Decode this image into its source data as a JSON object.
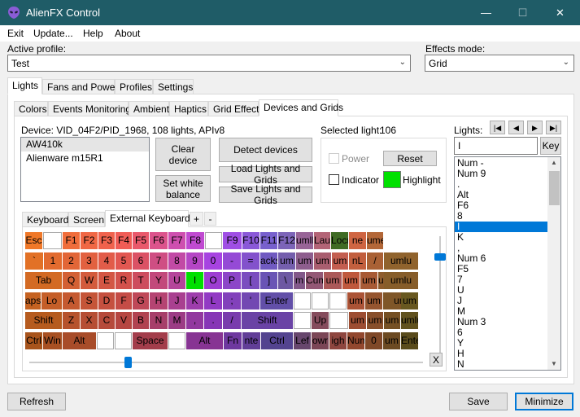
{
  "window": {
    "title": "AlienFX Control",
    "minimize": "—",
    "maximize": "☐",
    "close": "✕"
  },
  "menu": [
    "Exit",
    "Update...",
    "Help",
    "About"
  ],
  "profile": {
    "label": "Active profile:",
    "value": "Test"
  },
  "effects": {
    "label": "Effects mode:",
    "value": "Grid"
  },
  "main_tabs": [
    "Lights",
    "Fans and Power",
    "Profiles",
    "Settings"
  ],
  "sub_tabs": [
    "Colors",
    "Events Monitoring",
    "Ambient",
    "Haptics",
    "Grid Effect",
    "Devices and Grids"
  ],
  "device": {
    "info": "Device: VID_04F2/PID_1968, 108 lights, APIv8",
    "list": [
      "AW410k",
      "Alienware m15R1"
    ],
    "selected_index": 0
  },
  "buttons": {
    "clear_device": "Clear device",
    "detect_devices": "Detect devices",
    "set_white_balance": "Set white balance",
    "load_lights": "Load Lights and Grids",
    "save_lights": "Save Lights and Grids",
    "reset": "Reset",
    "refresh": "Refresh",
    "save": "Save",
    "minimize": "Minimize",
    "key": "Key",
    "grid_add": "+",
    "grid_remove": "-",
    "clear_x": "X"
  },
  "selected_light": {
    "label": "Selected light:",
    "value": "106"
  },
  "checks": {
    "power": "Power",
    "indicator": "Indicator",
    "highlight": "Highlight"
  },
  "colors": {
    "highlight": "#00e000",
    "accent": "#0078d7",
    "titlebar": "#1f5c67"
  },
  "grid_tabs": [
    "Keyboard",
    "Screen",
    "External Keyboard"
  ],
  "lights": {
    "label": "Lights:",
    "search": "I",
    "nav": [
      "|◀",
      "◀",
      "▶",
      "▶|"
    ],
    "items": [
      "Num -",
      "Num 9",
      ".",
      "Alt",
      "F6",
      "8",
      "I",
      "K",
      ",",
      "Num 6",
      "F5",
      "7",
      "U",
      "J",
      "M",
      "Num 3",
      "6",
      "Y",
      "H",
      "N"
    ],
    "selected_index": 6
  },
  "keyboard": {
    "rows": [
      [
        "Esc",
        "",
        "F1",
        "F2",
        "F3",
        "F4",
        "F5",
        "F6",
        "F7",
        "F8",
        "",
        "F9",
        "F10",
        "F11",
        "F12",
        "umlL",
        "Lause",
        "Locne",
        "ne",
        "ume"
      ],
      [
        "`",
        "1",
        "2",
        "3",
        "4",
        "5",
        "6",
        "7",
        "8",
        "9",
        "0",
        "-",
        "=",
        "acksp",
        "um",
        "um",
        "um",
        "um",
        "nL",
        "/",
        "umlu"
      ],
      [
        "Tab",
        "Q",
        "W",
        "E",
        "R",
        "T",
        "Y",
        "U",
        "I",
        "O",
        "P",
        "[",
        "]",
        "\\",
        "m",
        "Cum",
        "um",
        "um",
        "um",
        "um",
        "umlu"
      ],
      [
        "aps",
        "Lo",
        "A",
        "S",
        "D",
        "F",
        "G",
        "H",
        "J",
        "K",
        "L",
        ";",
        "'",
        "Enter",
        "",
        "",
        "",
        "um",
        "um",
        "um",
        "um"
      ],
      [
        "Shift",
        "Z",
        "X",
        "C",
        "V",
        "B",
        "N",
        "M",
        ",",
        ".",
        "/",
        "Shift",
        "",
        "Up",
        "",
        "um",
        "um",
        "um",
        "umlu"
      ],
      [
        "Ctrl",
        "Win",
        "Alt",
        "",
        "",
        "Space",
        "",
        "Alt",
        "Fn",
        "nte",
        "Ctrl",
        "Lef",
        "owr",
        "igh",
        "Num",
        "0",
        "um",
        "Ente"
      ]
    ]
  }
}
